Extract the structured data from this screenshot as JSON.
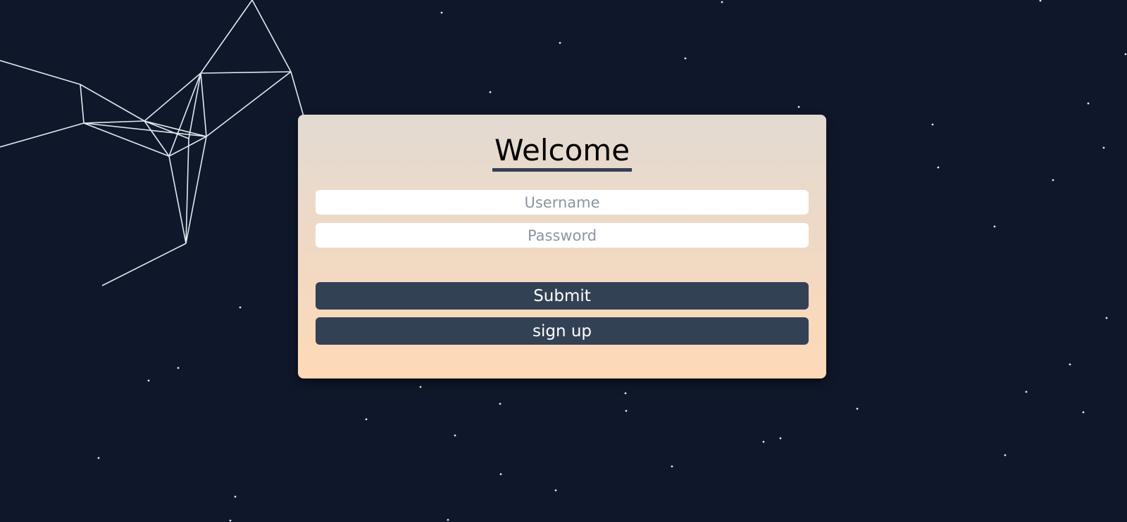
{
  "login": {
    "title": "Welcome",
    "username_placeholder": "Username",
    "password_placeholder": "Password",
    "submit_label": "Submit",
    "signup_label": "sign up"
  },
  "colors": {
    "background": "#0f172a",
    "button": "#334155",
    "card_top": "#e2dad2",
    "card_bottom": "#fed9b7",
    "title_underline": "#334155",
    "particles": "#e2e8f0"
  }
}
